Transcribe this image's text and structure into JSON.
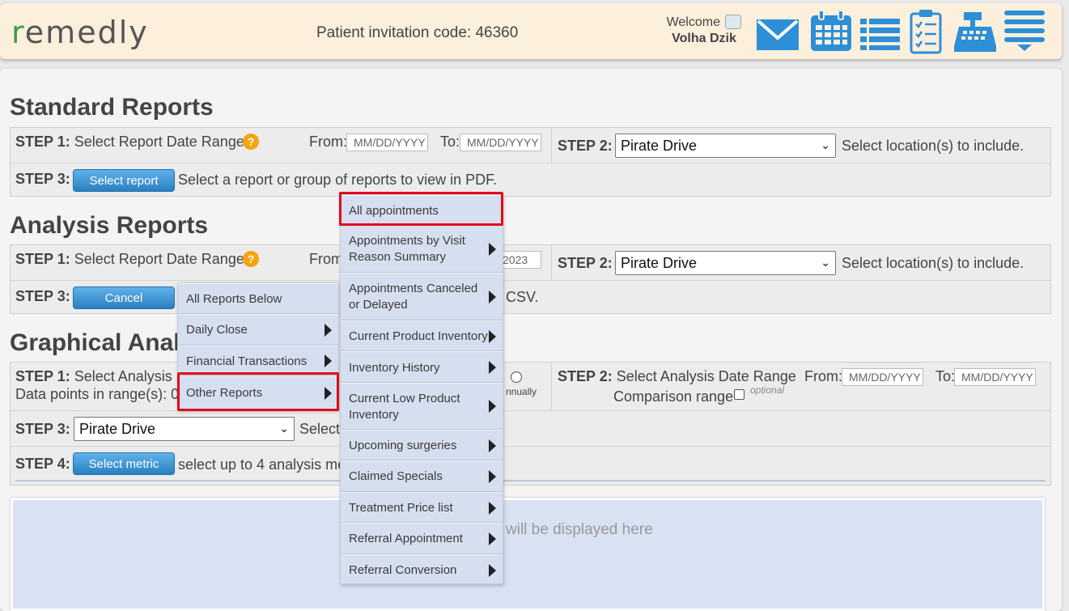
{
  "header": {
    "logo": "remedly",
    "invitation": "Patient invitation code: 46360",
    "welcome": "Welcome",
    "user_name": "Volha Dzik",
    "icons": [
      "mail-icon",
      "calendar-icon",
      "list-icon",
      "checklist-icon",
      "cash-register-icon",
      "menu-icon"
    ]
  },
  "standard": {
    "title": "Standard Reports",
    "step1_label": "STEP 1:",
    "step1_text": "Select Report Date Range",
    "from_label": "From:",
    "to_label": "To:",
    "date_placeholder": "MM/DD/YYYY",
    "step2_label": "STEP 2:",
    "location": "Pirate Drive",
    "location_hint": "Select location(s) to include.",
    "step3_label": "STEP 3:",
    "step3_button": "Select report",
    "step3_text": "Select a report or group of reports to view in PDF."
  },
  "analysis": {
    "title": "Analysis Reports",
    "step1_label": "STEP 1:",
    "step1_text": "Select Report Date Range",
    "from_partial": "From",
    "to_partial": "2023",
    "step2_label": "STEP 2:",
    "location": "Pirate Drive",
    "location_hint": "Select location(s) to include.",
    "step3_label": "STEP 3:",
    "step3_button": "Cancel",
    "step3_text_tail": "CSV."
  },
  "graphical": {
    "title_partial": "Graphical Anal",
    "step1_label": "STEP 1:",
    "step1_text": "Select Analysis P",
    "datapoints": "Data points in range(s): 0",
    "annually": "nnually",
    "step2_label": "STEP 2:",
    "step2_text": "Select Analysis Date Range",
    "from_label": "From:",
    "to_label": "To:",
    "date_placeholder": "MM/DD/YYYY",
    "comparison": "Comparison range",
    "optional": "optional",
    "step3_label": "STEP 3:",
    "location": "Pirate Drive",
    "step3_text": "Select",
    "step4_label": "STEP 4:",
    "step4_button": "Select metric",
    "step4_text": "select up to 4 analysis me",
    "display_text": "will be displayed here"
  },
  "menu_left": [
    {
      "label": "All Reports Below",
      "arrow": false
    },
    {
      "label": "Daily Close",
      "arrow": true
    },
    {
      "label": "Financial Transactions",
      "arrow": true
    },
    {
      "label": "Other Reports",
      "arrow": true
    }
  ],
  "menu_right": [
    {
      "label": "All appointments",
      "arrow": false
    },
    {
      "label": "Appointments by Visit Reason Summary",
      "arrow": true
    },
    {
      "label": "Appointments Canceled or Delayed",
      "arrow": true
    },
    {
      "label": "Current Product Inventory",
      "arrow": true
    },
    {
      "label": "Inventory History",
      "arrow": true
    },
    {
      "label": "Current Low Product Inventory",
      "arrow": true
    },
    {
      "label": "Upcoming surgeries",
      "arrow": true
    },
    {
      "label": "Claimed Specials",
      "arrow": true
    },
    {
      "label": "Treatment Price list",
      "arrow": true
    },
    {
      "label": "Referral Appointment",
      "arrow": true
    },
    {
      "label": "Referral Conversion",
      "arrow": true
    }
  ],
  "colors": {
    "accent_blue": "#2a7fc0",
    "highlight_red": "#e3081a",
    "menu_bg": "#d6dff0"
  }
}
